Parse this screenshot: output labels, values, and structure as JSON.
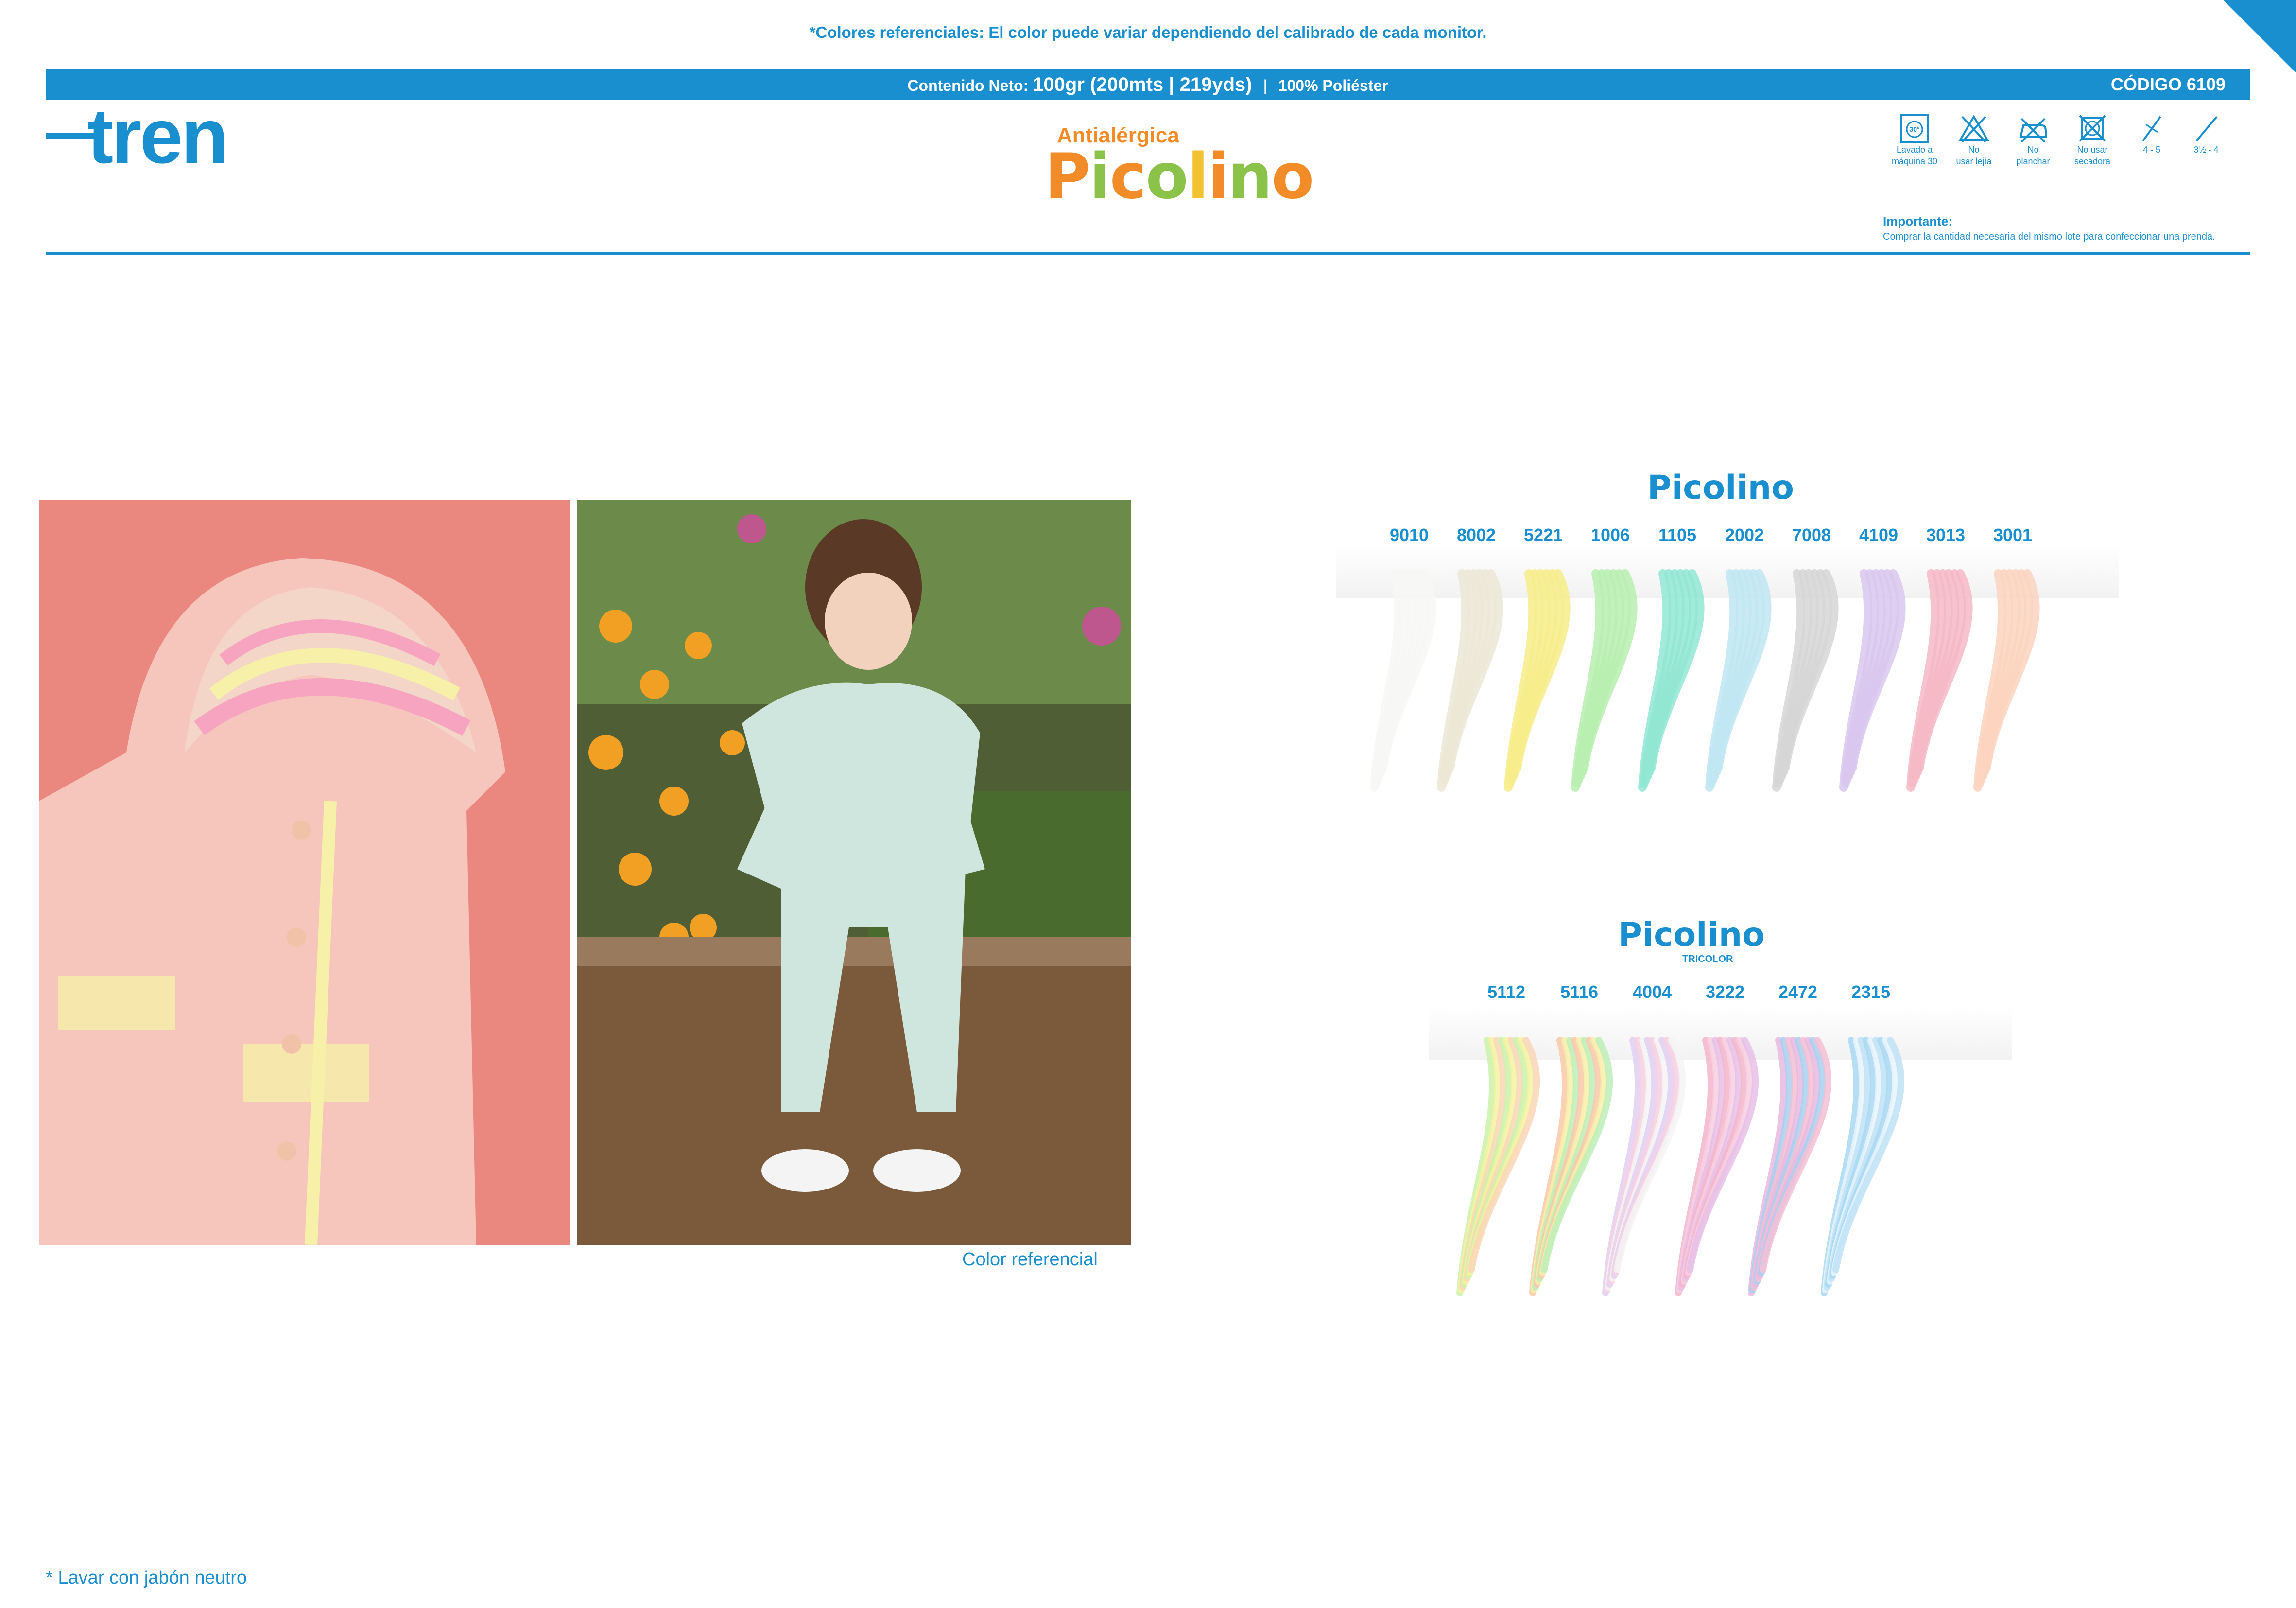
{
  "header": {
    "disclaimer": "*Colores referenciales: El color puede variar dependiendo del calibrado de cada monitor.",
    "net_label": "Contenido Neto:",
    "net_value": "100gr (200mts | 219yds)",
    "fiber": "100% Poliéster",
    "code_label": "CÓDIGO",
    "code_value": "6109"
  },
  "brand": {
    "name": "tren",
    "color": "#1a8fd0"
  },
  "product": {
    "tagline": "Antialérgica",
    "name": "Picolino",
    "letter_colors": [
      "#f28c28",
      "#8bc34a",
      "#f28c28",
      "#8bc34a",
      "#f2c230",
      "#f28c28",
      "#8bc34a",
      "#f28c28"
    ]
  },
  "care": [
    {
      "icon": "machine-wash-30-icon",
      "label_1": "Lavado a",
      "label_2": "máquina 30"
    },
    {
      "icon": "no-bleach-icon",
      "label_1": "No",
      "label_2": "usar lejía"
    },
    {
      "icon": "no-iron-icon",
      "label_1": "No",
      "label_2": "planchar"
    },
    {
      "icon": "no-tumble-dry-icon",
      "label_1": "No usar",
      "label_2": "secadora"
    },
    {
      "icon": "crochet-hook-icon",
      "label_1": "4 - 5",
      "label_2": ""
    },
    {
      "icon": "knitting-needle-icon",
      "label_1": "3½ - 4",
      "label_2": ""
    }
  ],
  "important": {
    "title": "Importante:",
    "text": "Comprar la cantidad necesaria del mismo lote para confeccionar una prenda."
  },
  "photos": {
    "color_ref": "Color referencial",
    "left_bg": "#ea8880"
  },
  "swatches_solid": {
    "logo": "Picolino",
    "items": [
      {
        "code": "9010",
        "color": "#f7f7f5"
      },
      {
        "code": "8002",
        "color": "#ece7d6"
      },
      {
        "code": "5221",
        "color": "#f7ec8a"
      },
      {
        "code": "1006",
        "color": "#b9efb0"
      },
      {
        "code": "1105",
        "color": "#92e6d2"
      },
      {
        "code": "2002",
        "color": "#bfe6f2"
      },
      {
        "code": "7008",
        "color": "#d6d6d6"
      },
      {
        "code": "4109",
        "color": "#d9c7ee"
      },
      {
        "code": "3013",
        "color": "#f6b8c6"
      },
      {
        "code": "3001",
        "color": "#fbd3c0"
      }
    ]
  },
  "swatches_tricolor": {
    "logo": "Picolino",
    "sub": "TRICOLOR",
    "items": [
      {
        "code": "5112",
        "colors": [
          "#cdf2a8",
          "#f4f2a0",
          "#f9d6b8"
        ]
      },
      {
        "code": "5116",
        "colors": [
          "#f9c9a8",
          "#f7f0a9",
          "#bdeeb8"
        ]
      },
      {
        "code": "4004",
        "colors": [
          "#e0d0f2",
          "#f7d0e0",
          "#f4f4f4"
        ]
      },
      {
        "code": "3222",
        "colors": [
          "#f5b5cb",
          "#f8cfe0",
          "#e6c0e8"
        ]
      },
      {
        "code": "2472",
        "colors": [
          "#e8b8e0",
          "#a8d0f0",
          "#f4c0d4"
        ]
      },
      {
        "code": "2315",
        "colors": [
          "#a8d8f2",
          "#e8f4fb",
          "#c0e2f6"
        ]
      }
    ]
  },
  "footnote": "* Lavar con jabón neutro"
}
